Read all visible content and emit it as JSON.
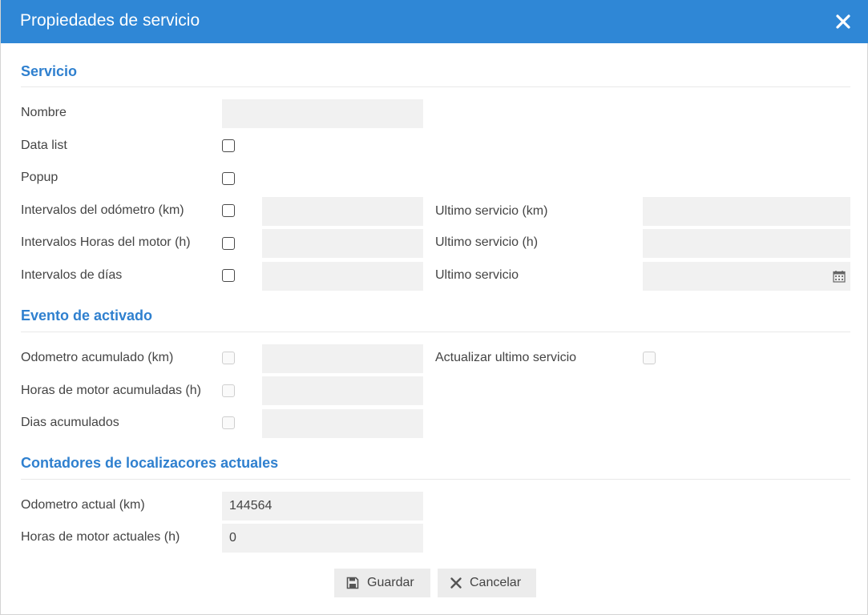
{
  "dialog": {
    "title": "Propiedades de servicio"
  },
  "sections": {
    "servicio": "Servicio",
    "evento": "Evento de activado",
    "contadores": "Contadores de localizacores actuales"
  },
  "servicio": {
    "nombre_label": "Nombre",
    "nombre_value": "",
    "data_list_label": "Data list",
    "popup_label": "Popup",
    "odometro_label": "Intervalos del odómetro (km)",
    "horas_label": "Intervalos Horas del motor (h)",
    "dias_label": "Intervalos de días",
    "ultimo_km_label": "Ultimo servicio (km)",
    "ultimo_h_label": "Ultimo servicio (h)",
    "ultimo_label": "Ultimo servicio"
  },
  "evento": {
    "odometro_label": "Odometro acumulado (km)",
    "horas_label": "Horas de motor acumuladas (h)",
    "dias_label": "Dias acumulados",
    "actualizar_label": "Actualizar ultimo servicio"
  },
  "contadores": {
    "odometro_label": "Odometro actual (km)",
    "odometro_value": "144564",
    "horas_label": "Horas de motor actuales (h)",
    "horas_value": "0"
  },
  "buttons": {
    "save": "Guardar",
    "cancel": "Cancelar"
  },
  "icons": {
    "close": "close-icon",
    "calendar": "calendar-icon",
    "save": "floppy-disk-icon",
    "cancel": "x-icon"
  },
  "colors": {
    "titlebar": "#2f87d6",
    "section": "#2f80cf"
  }
}
